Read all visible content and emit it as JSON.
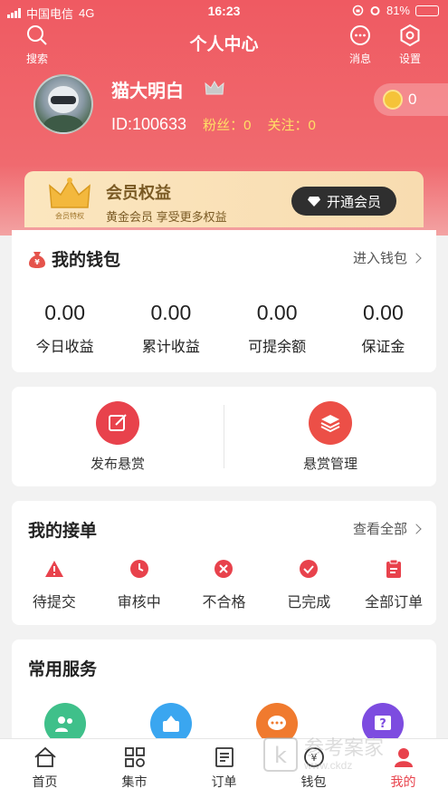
{
  "status_bar": {
    "carrier": "中国电信",
    "network": "4G",
    "time": "16:23",
    "battery": "81%",
    "battery_level": 0.81
  },
  "topbar": {
    "title": "个人中心",
    "search_label": "搜索",
    "message_label": "消息",
    "settings_label": "设置"
  },
  "profile": {
    "nickname": "猫大明白",
    "id_text": "ID:100633",
    "fans_label": "粉丝：",
    "fans": "0",
    "follow_label": "关注：",
    "follow": "0",
    "coins": "0"
  },
  "vip": {
    "title": "会员权益",
    "subtitle": "黄金会员 享受更多权益",
    "button": "开通会员",
    "badge_text": "会员特权"
  },
  "wallet": {
    "title": "我的钱包",
    "more": "进入钱包",
    "items": [
      {
        "value": "0.00",
        "label": "今日收益"
      },
      {
        "value": "0.00",
        "label": "累计收益"
      },
      {
        "value": "0.00",
        "label": "可提余额"
      },
      {
        "value": "0.00",
        "label": "保证金"
      }
    ]
  },
  "bounty": {
    "publish": "发布悬赏",
    "manage": "悬赏管理"
  },
  "orders": {
    "title": "我的接单",
    "more": "查看全部",
    "items": [
      {
        "label": "待提交",
        "icon": "warning-icon"
      },
      {
        "label": "审核中",
        "icon": "clock-icon"
      },
      {
        "label": "不合格",
        "icon": "x-circle-icon"
      },
      {
        "label": "已完成",
        "icon": "check-circle-icon"
      },
      {
        "label": "全部订单",
        "icon": "clipboard-icon"
      }
    ]
  },
  "services": {
    "title": "常用服务"
  },
  "tabs": [
    {
      "label": "首页",
      "icon": "home-icon"
    },
    {
      "label": "集市",
      "icon": "market-icon"
    },
    {
      "label": "订单",
      "icon": "order-icon"
    },
    {
      "label": "钱包",
      "icon": "wallet-icon"
    },
    {
      "label": "我的",
      "icon": "profile-icon"
    }
  ],
  "colors": {
    "accent": "#ef5a62",
    "gold": "#ffe066",
    "vip_text": "#7a5a24"
  },
  "watermark": {
    "text": "参考案家",
    "url": "www.ckdz"
  }
}
